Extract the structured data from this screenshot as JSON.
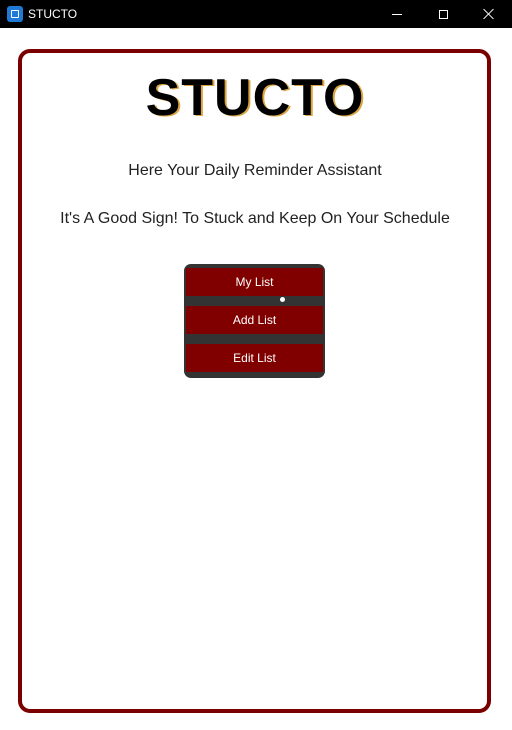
{
  "window": {
    "title": "STUCTO",
    "icon": "app-window-icon",
    "controls": [
      "minimize",
      "maximize",
      "close"
    ]
  },
  "main": {
    "app_title": "STUCTO",
    "subtitle": "Here Your Daily Reminder Assistant",
    "tagline": "It's A Good Sign! To Stuck and Keep On Your Schedule"
  },
  "menu": {
    "items": [
      {
        "label": "My List"
      },
      {
        "label": "Add List"
      },
      {
        "label": "Edit List"
      }
    ]
  },
  "colors": {
    "frame": "#7a0000",
    "button_bg": "#800000",
    "panel_bg": "#333333",
    "titlebar_bg": "#000000"
  }
}
